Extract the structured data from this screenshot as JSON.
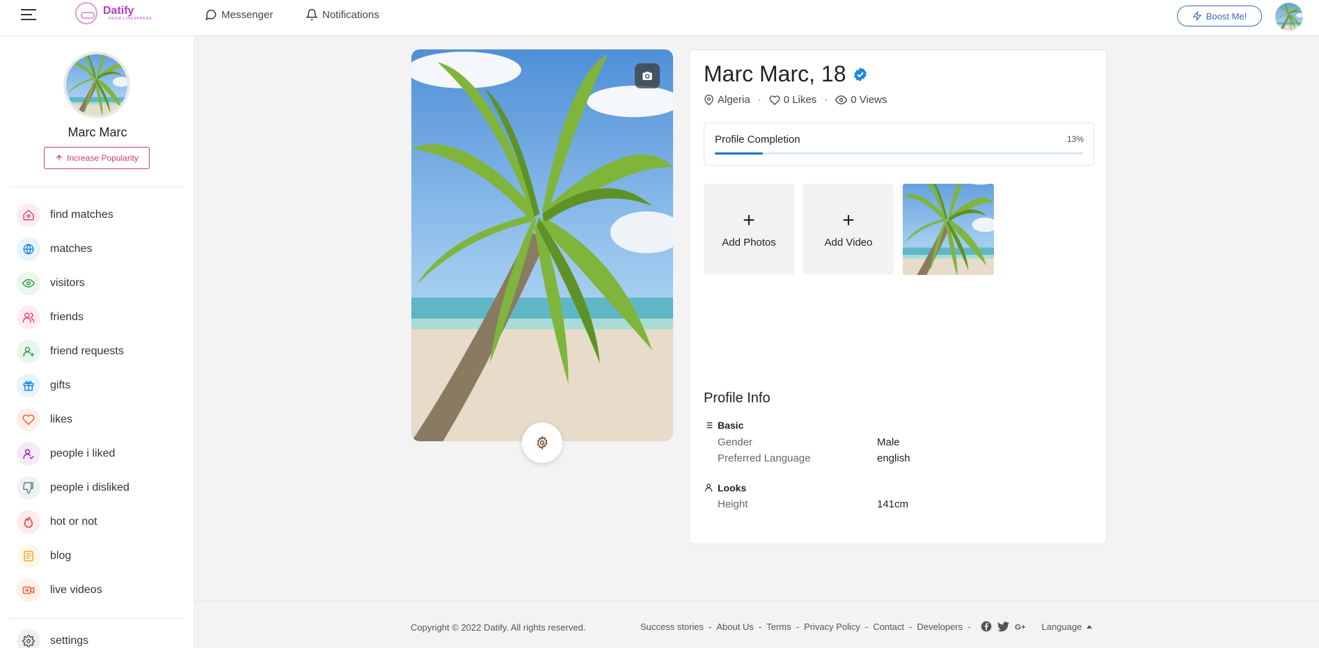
{
  "header": {
    "logo_title": "Datify",
    "logo_subtitle": "FROM LINKSPHERE",
    "nav": [
      {
        "label": "Messenger",
        "icon": "chat-bubble-icon"
      },
      {
        "label": "Notifications",
        "icon": "bell-icon"
      }
    ],
    "boost_label": "Boost Me!"
  },
  "sidebar": {
    "user_name": "Marc Marc",
    "popularity_label": "Increase Popularity",
    "items": [
      {
        "label": "find matches",
        "icon": "home-heart-icon",
        "color": "#e0457b"
      },
      {
        "label": "matches",
        "icon": "globe-icon",
        "color": "#1e88e5"
      },
      {
        "label": "visitors",
        "icon": "eye-icon",
        "color": "#2e9d4a"
      },
      {
        "label": "friends",
        "icon": "users-icon",
        "color": "#e0457b"
      },
      {
        "label": "friend requests",
        "icon": "user-plus-icon",
        "color": "#2e9d4a"
      },
      {
        "label": "gifts",
        "icon": "gift-icon",
        "color": "#1e88e5"
      },
      {
        "label": "likes",
        "icon": "heart-icon",
        "color": "#f0642c"
      },
      {
        "label": "people i liked",
        "icon": "user-check-icon",
        "color": "#9c27b0"
      },
      {
        "label": "people i disliked",
        "icon": "thumbs-down-icon",
        "color": "#607d8b"
      },
      {
        "label": "hot or not",
        "icon": "flame-icon",
        "color": "#e53935"
      },
      {
        "label": "blog",
        "icon": "document-icon",
        "color": "#f5a623"
      },
      {
        "label": "live videos",
        "icon": "video-icon",
        "color": "#f0642c"
      }
    ],
    "settings_label": "settings"
  },
  "profile": {
    "name": "Marc Marc, 18",
    "location": "Algeria",
    "likes": "0 Likes",
    "views": "0 Views",
    "completion_label": "Profile Completion",
    "completion_pct_text": "13%",
    "completion_pct": 13,
    "add_photos": "Add Photos",
    "add_video": "Add Video",
    "info_title": "Profile Info",
    "basic_title": "Basic",
    "basic_rows": [
      {
        "key": "Gender",
        "value": "Male"
      },
      {
        "key": "Preferred Language",
        "value": "english"
      }
    ],
    "looks_title": "Looks",
    "looks_rows": [
      {
        "key": "Height",
        "value": "141cm"
      }
    ]
  },
  "footer": {
    "copyright": "Copyright © 2022 Datify. All rights reserved.",
    "links": [
      "Success stories",
      "About Us",
      "Terms",
      "Privacy Policy",
      "Contact",
      "Developers"
    ],
    "language_label": "Language"
  }
}
